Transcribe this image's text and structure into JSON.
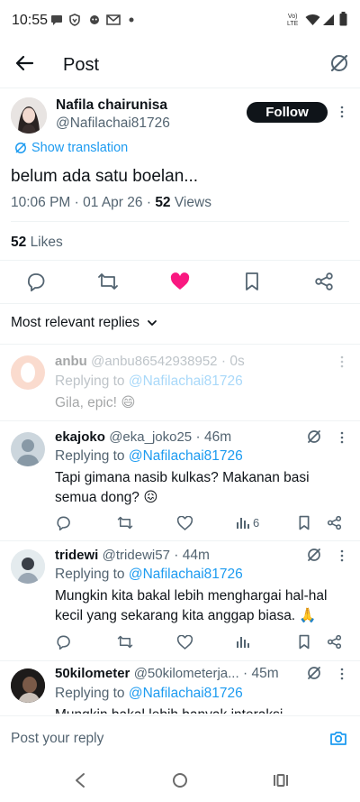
{
  "status_bar": {
    "time": "10:55",
    "network_label_1": "Vo)",
    "network_label_2": "LTE"
  },
  "header": {
    "title": "Post"
  },
  "post": {
    "author_name": "Nafila chairunisa",
    "author_handle": "@Nafilachai81726",
    "follow_label": "Follow",
    "show_translation": "Show translation",
    "text": "belum ada satu boelan...",
    "time": "10:06 PM",
    "date": "01 Apr 26",
    "views_count": "52",
    "views_label": "Views",
    "likes_count": "52",
    "likes_label": "Likes",
    "sep": "·"
  },
  "replies_filter": {
    "label": "Most relevant replies"
  },
  "replies": [
    {
      "name": "anbu",
      "handle": "@anbu86542938952",
      "sep": "·",
      "time": "0s",
      "replying_to_label": "Replying to",
      "replying_to": "@Nafilachai81726",
      "text": "Gila, epic! 😄"
    },
    {
      "name": "ekajoko",
      "handle": "@eka_joko25",
      "sep": "·",
      "time": "46m",
      "replying_to_label": "Replying to",
      "replying_to": "@Nafilachai81726",
      "text_line1": "Tapi gimana nasib kulkas? Makanan basi",
      "text_line2": "semua dong? 😖",
      "views": "6"
    },
    {
      "name": "tridewi",
      "handle": "@tridewi57",
      "sep": "·",
      "time": "44m",
      "replying_to_label": "Replying to",
      "replying_to": "@Nafilachai81726",
      "text_line1": "Mungkin kita bakal lebih menghargai hal-hal",
      "text_line2": "kecil yang sekarang kita anggap biasa. 🙏"
    },
    {
      "name": "50kilometer",
      "handle": "@50kilometerja...",
      "sep": "·",
      "time": "45m",
      "replying_to_label": "Replying to",
      "replying_to": "@Nafilachai81726",
      "text_line1": "Mungkin bakal lebih banyak interaksi"
    }
  ],
  "composer": {
    "placeholder": "Post your reply"
  },
  "colors": {
    "accent": "#1d9bf0",
    "like": "#f91880",
    "text": "#0f1419",
    "secondary": "#536471"
  }
}
